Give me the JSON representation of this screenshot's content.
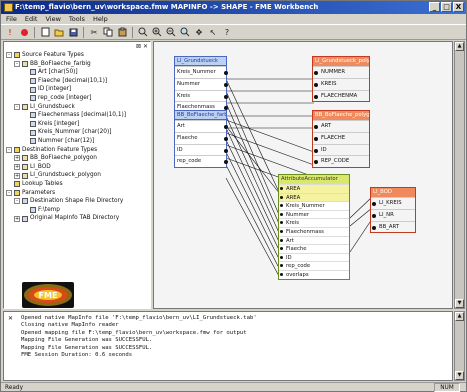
{
  "window": {
    "title": "F:\\temp_flavio\\bern_uv\\workspace.fmw  MAPINFO -> SHAPE - FME Workbench",
    "btn_minimize": "_",
    "btn_maximize": "□",
    "btn_close": "X"
  },
  "menu": [
    "File",
    "Edit",
    "View",
    "Tools",
    "Help"
  ],
  "toolbar_icons": [
    "run-icon",
    "stop-icon",
    "new-icon",
    "open-icon",
    "save-icon",
    "cut-icon",
    "copy-icon",
    "paste-icon",
    "zoom-icon",
    "zoom-in-icon",
    "zoom-out-icon",
    "fit-icon",
    "pan-icon",
    "pointer-icon",
    "help-icon"
  ],
  "navigator": {
    "items": [
      {
        "depth": 0,
        "exp": "-",
        "icon": "folder",
        "label": "Source Feature Types"
      },
      {
        "depth": 1,
        "exp": "-",
        "icon": "ft",
        "label": "BB_BoFlaeche_farbig"
      },
      {
        "depth": 2,
        "exp": "",
        "icon": "attr",
        "label": "Art [char(50)]"
      },
      {
        "depth": 2,
        "exp": "",
        "icon": "attr",
        "label": "Flaeche [decimal(10,1)]"
      },
      {
        "depth": 2,
        "exp": "",
        "icon": "attr",
        "label": "ID [integer]"
      },
      {
        "depth": 2,
        "exp": "",
        "icon": "attr",
        "label": "rep_code [integer]"
      },
      {
        "depth": 1,
        "exp": "-",
        "icon": "ft",
        "label": "LI_Grundstueck"
      },
      {
        "depth": 2,
        "exp": "",
        "icon": "attr",
        "label": "Flaechenmass [decimal(10,1)]"
      },
      {
        "depth": 2,
        "exp": "",
        "icon": "attr",
        "label": "Kreis [integer]"
      },
      {
        "depth": 2,
        "exp": "",
        "icon": "attr",
        "label": "Kreis_Nummer [char(20)]"
      },
      {
        "depth": 2,
        "exp": "",
        "icon": "attr",
        "label": "Nummer [char(12)]"
      },
      {
        "depth": 0,
        "exp": "-",
        "icon": "folder",
        "label": "Destination Feature Types"
      },
      {
        "depth": 1,
        "exp": "+",
        "icon": "ft",
        "label": "BB_BoFlaeche_polygon"
      },
      {
        "depth": 1,
        "exp": "+",
        "icon": "ft",
        "label": "LI_BOD"
      },
      {
        "depth": 1,
        "exp": "+",
        "icon": "ft",
        "label": "LI_Grundstueck_polygon"
      },
      {
        "depth": 0,
        "exp": "",
        "icon": "folder",
        "label": "Lookup Tables"
      },
      {
        "depth": 0,
        "exp": "-",
        "icon": "folder",
        "label": "Parameters"
      },
      {
        "depth": 1,
        "exp": "-",
        "icon": "attr",
        "label": "Destination Shape File Directory"
      },
      {
        "depth": 2,
        "exp": "",
        "icon": "attr",
        "label": "F:\\temp"
      },
      {
        "depth": 1,
        "exp": "+",
        "icon": "attr",
        "label": "Original MapInfo TAB Directory"
      }
    ]
  },
  "logo": {
    "text": "FME"
  },
  "canvas": {
    "src_grund": {
      "title": "LI_Grundstueck",
      "attrs": [
        "Kreis_Nummer",
        "Nummer",
        "Kreis",
        "Flaechenmass"
      ]
    },
    "src_boflaeche": {
      "title": "BB_BoFlaeche_farbig",
      "attrs": [
        "Art",
        "Flaeche",
        "ID",
        "rep_code"
      ]
    },
    "dst_grund": {
      "title": "LI_Grundstueck_polygon",
      "attrs": [
        "NUMMER",
        "KREIS",
        "FLAECHENMA"
      ]
    },
    "dst_boflaeche": {
      "title": "BB_BoFlaeche_polygon",
      "attrs": [
        "ART",
        "FLAECHE",
        "ID",
        "REP_CODE"
      ]
    },
    "transformer": {
      "title": "AttributeAccumulator",
      "rows": [
        "AREA",
        "AREA",
        "Kreis_Nummer",
        "Nummer",
        "Kreis",
        "Flaechenmass",
        "Art",
        "Flaeche",
        "ID",
        "rep_code",
        "overlaps"
      ]
    },
    "dst_bod": {
      "title": "LI_BOD",
      "attrs": [
        "LI_KREIS",
        "LI_NR",
        "BB_ART"
      ]
    }
  },
  "log": [
    "Opened native MapInfo file 'F:\\temp_flavio\\bern_uv\\LI_Grundstueck.tab'",
    "Closing native MapInfo reader",
    "Opened mapping file F:\\temp_flavio\\bern_uv\\workspace.fmw for output",
    "Mapping File Generation was SUCCESSFUL.",
    "Mapping File Generation was SUCCESSFUL.",
    "FME Session Duration: 0.6 seconds"
  ],
  "status": {
    "left": "Ready",
    "right": "NUM"
  },
  "colors": {
    "source": "#bcd0f4",
    "destination": "#f08a5c",
    "transformer": "#d9e86b",
    "titlebar": "#0b2a8a"
  }
}
